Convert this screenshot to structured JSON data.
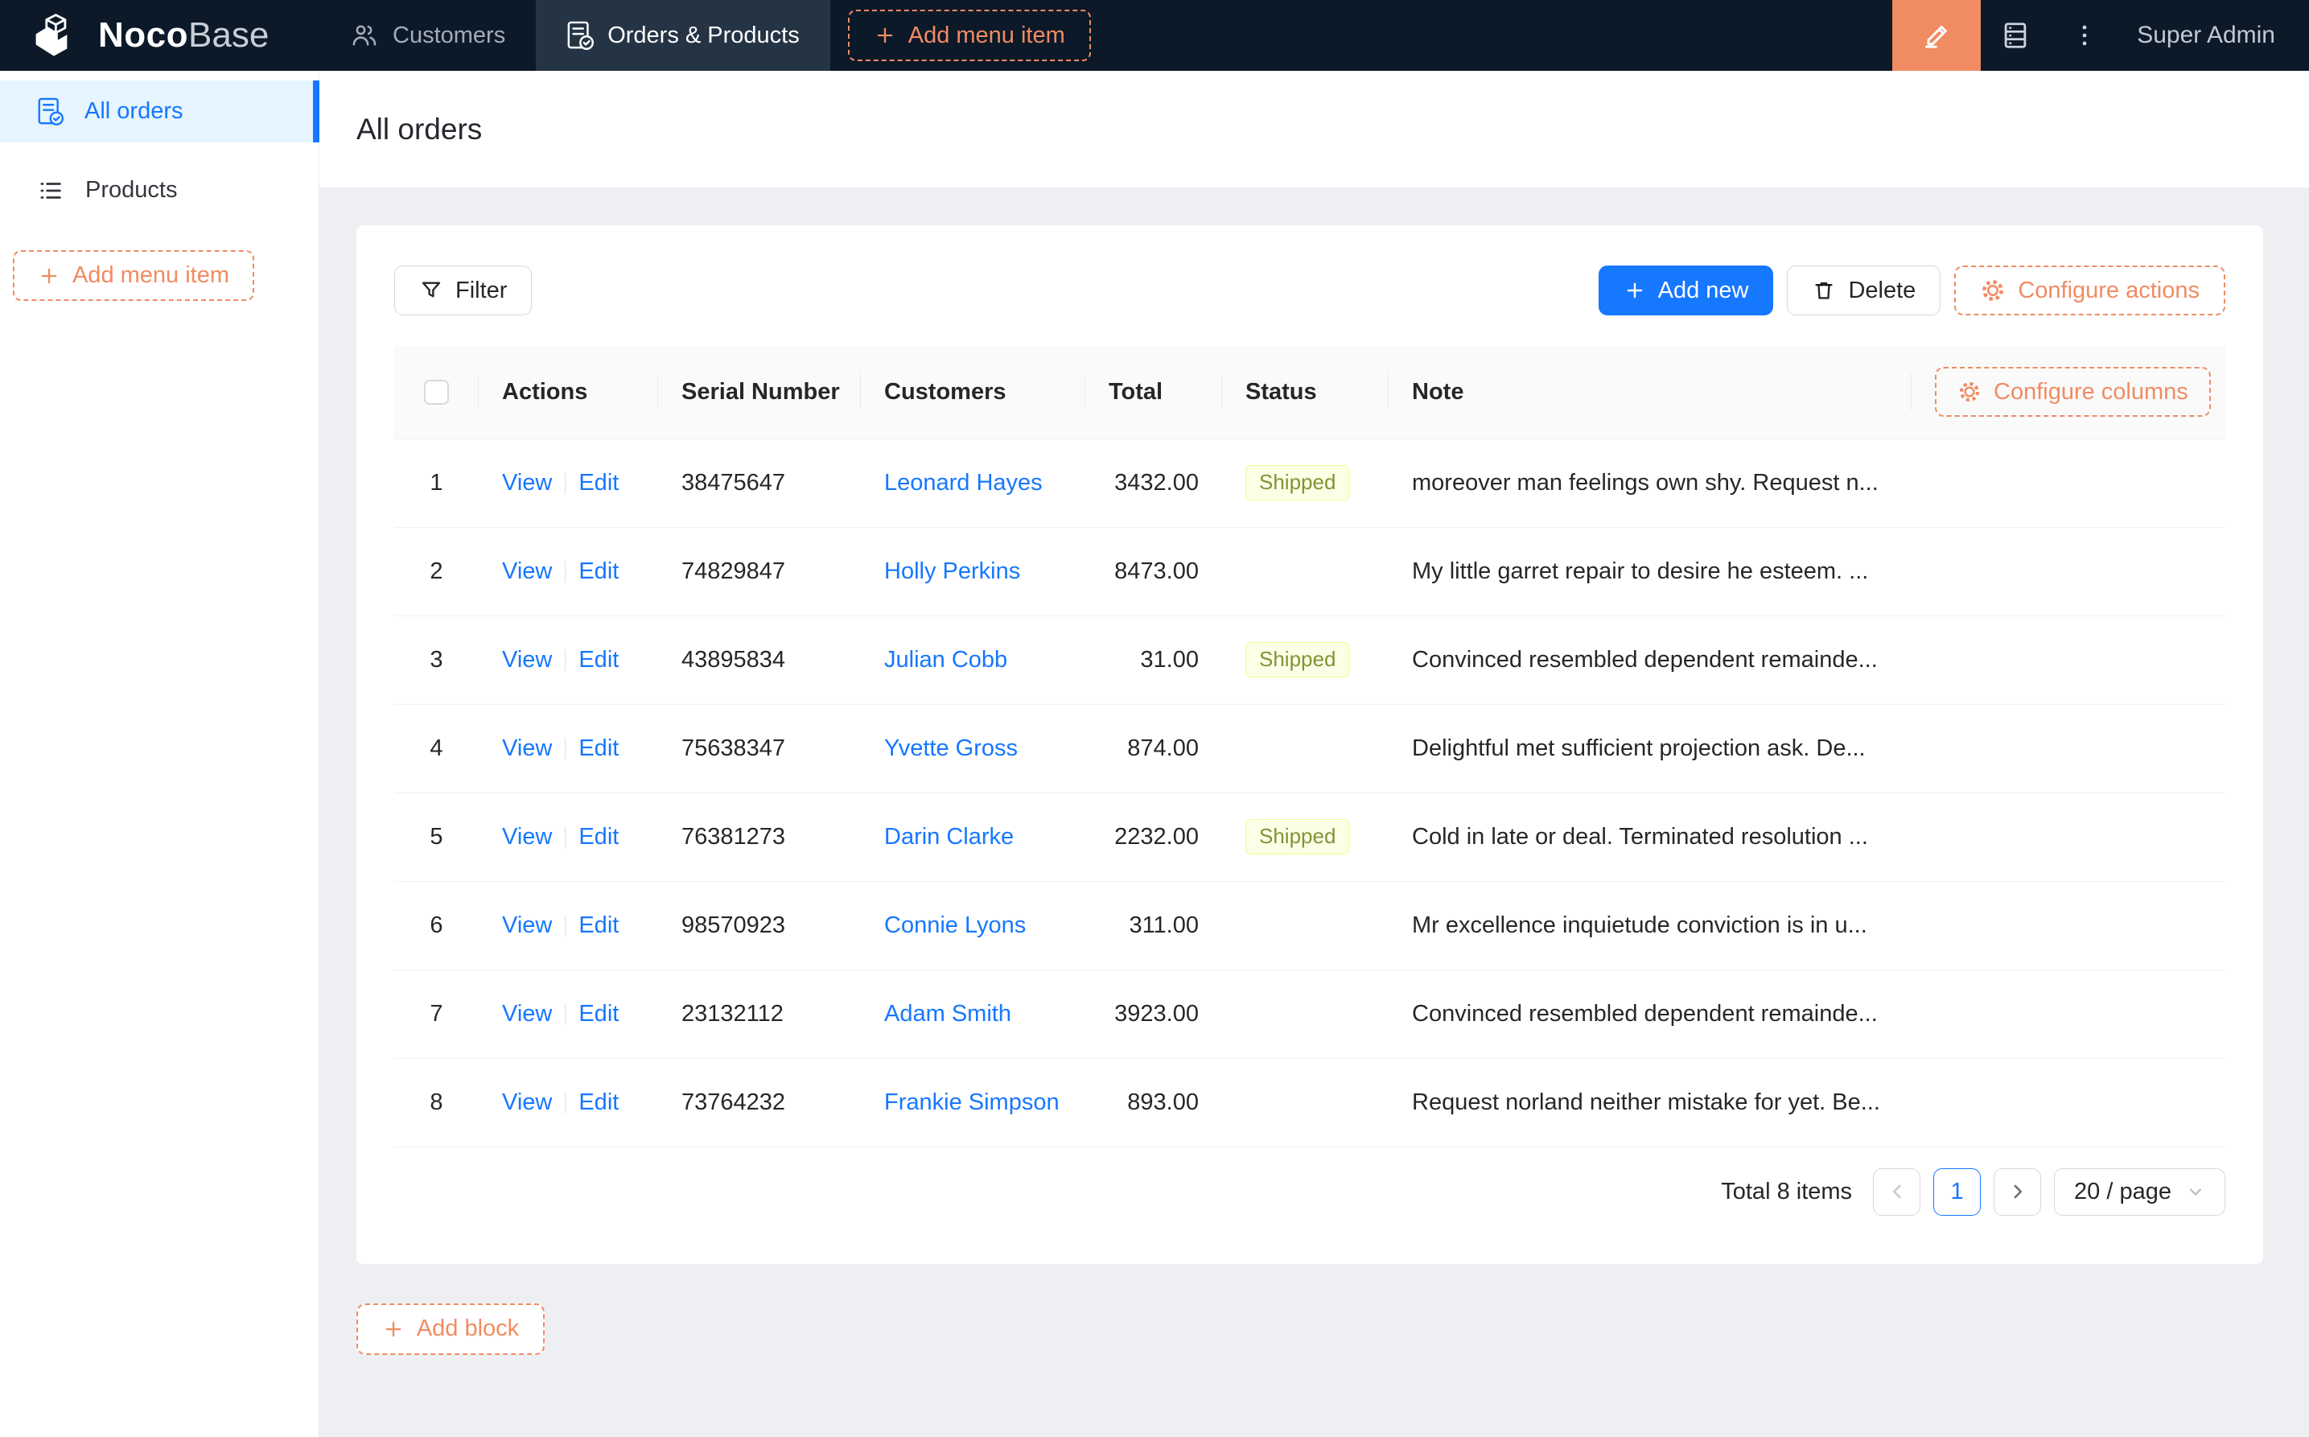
{
  "header": {
    "logo_bold": "Noco",
    "logo_light": "Base",
    "nav": [
      {
        "label": "Customers",
        "active": false
      },
      {
        "label": "Orders & Products",
        "active": true
      }
    ],
    "add_menu_item": "Add menu item",
    "user": "Super Admin"
  },
  "sidebar": {
    "items": [
      {
        "label": "All orders",
        "active": true
      },
      {
        "label": "Products",
        "active": false
      }
    ],
    "add_menu_item": "Add menu item"
  },
  "page": {
    "title": "All orders"
  },
  "toolbar": {
    "filter": "Filter",
    "add_new": "Add new",
    "delete": "Delete",
    "configure_actions": "Configure actions"
  },
  "table": {
    "configure_columns": "Configure columns",
    "columns": [
      "Actions",
      "Serial Number",
      "Customers",
      "Total",
      "Status",
      "Note"
    ],
    "action_labels": {
      "view": "View",
      "edit": "Edit"
    },
    "rows": [
      {
        "index": "1",
        "serial": "38475647",
        "customer": "Leonard Hayes",
        "total": "3432.00",
        "status": "Shipped",
        "note": "moreover man feelings own shy. Request n..."
      },
      {
        "index": "2",
        "serial": "74829847",
        "customer": "Holly Perkins",
        "total": "8473.00",
        "status": "",
        "note": "My little garret repair to desire he esteem. ..."
      },
      {
        "index": "3",
        "serial": "43895834",
        "customer": "Julian Cobb",
        "total": "31.00",
        "status": "Shipped",
        "note": "Convinced resembled dependent remainde..."
      },
      {
        "index": "4",
        "serial": "75638347",
        "customer": "Yvette Gross",
        "total": "874.00",
        "status": "",
        "note": "Delightful met sufficient projection ask. De..."
      },
      {
        "index": "5",
        "serial": "76381273",
        "customer": "Darin Clarke",
        "total": "2232.00",
        "status": "Shipped",
        "note": "Cold in late or deal. Terminated resolution ..."
      },
      {
        "index": "6",
        "serial": "98570923",
        "customer": "Connie Lyons",
        "total": "311.00",
        "status": "",
        "note": "Mr excellence inquietude conviction is in u..."
      },
      {
        "index": "7",
        "serial": "23132112",
        "customer": "Adam Smith",
        "total": "3923.00",
        "status": "",
        "note": "Convinced resembled dependent remainde..."
      },
      {
        "index": "8",
        "serial": "73764232",
        "customer": "Frankie Simpson",
        "total": "893.00",
        "status": "",
        "note": "Request norland neither mistake for yet. Be..."
      }
    ]
  },
  "pagination": {
    "total": "Total 8 items",
    "page": "1",
    "page_size": "20 / page"
  },
  "add_block": "Add block",
  "colors": {
    "accent-orange": "#f18b62",
    "primary-blue": "#1677ff",
    "header-bg": "#0c1929",
    "tab-active-bg": "#253445",
    "sidebar-active-bg": "#e6f5ff",
    "content-bg": "#edeff3",
    "table-header-bg": "#fafafa",
    "border-gray": "#f0f0f0",
    "badge-bg": "#fcffe6",
    "badge-border": "#eaff8f",
    "badge-text": "#7f9435"
  }
}
